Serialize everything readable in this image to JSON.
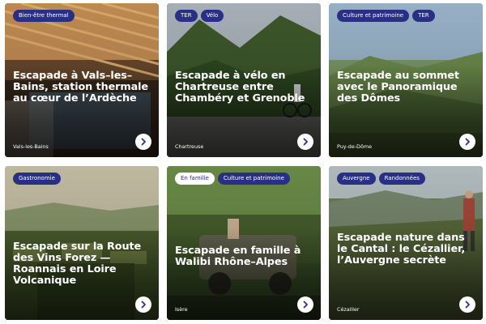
{
  "cards": [
    {
      "tags": [
        "Bien-être thermal"
      ],
      "title": "Escapade à Vals–les–Bains, station thermale au cœur de l’Ardèche",
      "location": "Vals-les-Bains",
      "icon": "chevron-right-icon"
    },
    {
      "tags": [
        "TER",
        "Vélo"
      ],
      "title": "Escapade à vélo en Chartreuse entre Chambéry et Grenoble",
      "location": "Chartreuse",
      "icon": "chevron-right-icon"
    },
    {
      "tags": [
        "Culture et patrimoine",
        "TER"
      ],
      "title": "Escapade au sommet avec le Panoramique des Dômes",
      "location": "Puy-de-Dôme",
      "icon": "chevron-right-icon"
    },
    {
      "tags": [
        "Gastronomie"
      ],
      "title": "Escapade sur la Route des Vins Forez — Roannais en Loire Volcanique",
      "location": "",
      "icon": "chevron-right-icon"
    },
    {
      "tags": [
        "En famille",
        "Culture et patrimoine"
      ],
      "title": "Escapade en famille à Walibi Rhône–Alpes",
      "location": "Isère",
      "icon": "chevron-right-icon"
    },
    {
      "tags": [
        "Auvergne",
        "Randonnées"
      ],
      "title": "Escapade nature dans le Cantal : le Cézallier, l’Auvergne secrète",
      "location": "Cézallier",
      "icon": "chevron-right-icon"
    }
  ],
  "colors": {
    "tag_bg": "#2a2f86",
    "tag_text": "#ffffff",
    "button_bg": "#ffffff",
    "arrow": "#2a2f86"
  }
}
